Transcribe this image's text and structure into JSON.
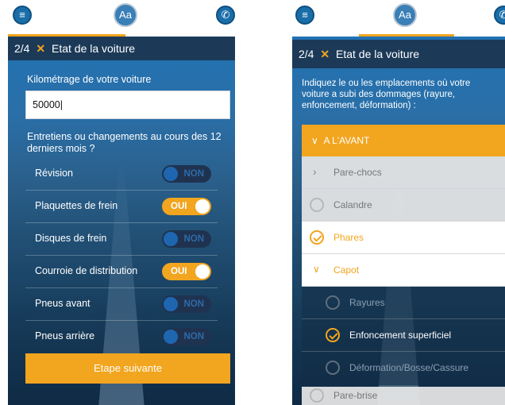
{
  "header": {
    "menu_icon": "menu-icon",
    "font_icon_label": "Aa",
    "phone_icon": "phone-icon"
  },
  "step": {
    "title": "2/4",
    "subtitle": "Etat de la voiture"
  },
  "left": {
    "mileage_label": "Kilométrage de votre voiture",
    "mileage_value": "50000",
    "maintenance_question": "Entretiens ou changements au cours des 12 derniers mois ?",
    "items": [
      {
        "label": "Révision",
        "state": "NON"
      },
      {
        "label": "Plaquettes de frein",
        "state": "OUI"
      },
      {
        "label": "Disques de frein",
        "state": "NON"
      },
      {
        "label": "Courroie de distribution",
        "state": "OUI"
      },
      {
        "label": "Pneus avant",
        "state": "NON"
      },
      {
        "label": "Pneus arrière",
        "state": "NON"
      }
    ],
    "next_button": "Etape suivante"
  },
  "right": {
    "instructions": "Indiquez le ou les emplacements où votre voiture a subi des dommages (rayure, enfoncement, déformation) :",
    "section_front": "A L'AVANT",
    "items": [
      {
        "label": "Pare-chocs",
        "type": "chevron"
      },
      {
        "label": "Calandre",
        "type": "unchecked"
      },
      {
        "label": "Phares",
        "type": "checked"
      },
      {
        "label": "Capot",
        "type": "expanded"
      }
    ],
    "sub_items": [
      {
        "label": "Rayures",
        "type": "unchecked"
      },
      {
        "label": "Enfoncement superficiel",
        "type": "checked"
      },
      {
        "label": "Déformation/Bosse/Cassure",
        "type": "unchecked"
      }
    ],
    "last_item": "Pare-brise"
  },
  "colors": {
    "accent": "#f2a51f",
    "blue": "#1a6ea8",
    "dark": "#1c3a58"
  }
}
